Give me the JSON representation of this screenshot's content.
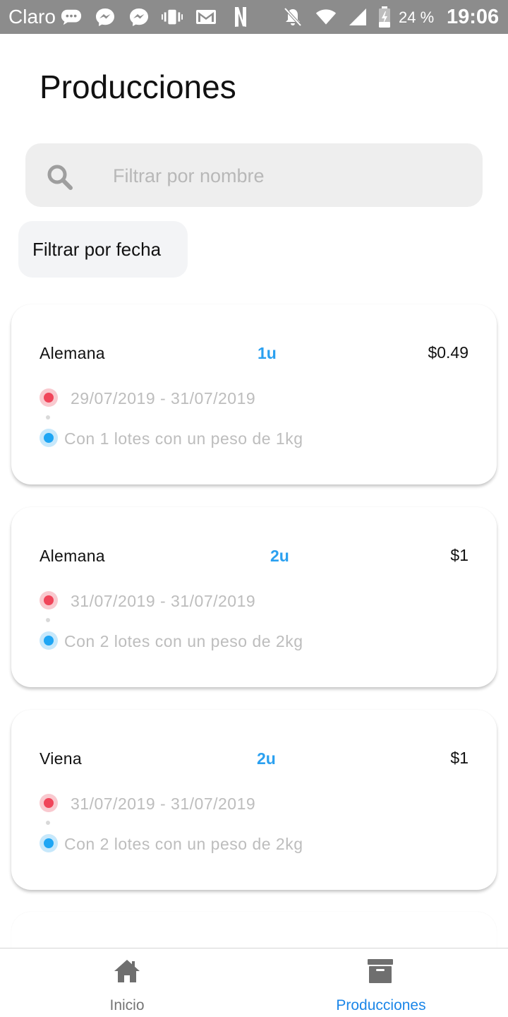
{
  "status_bar": {
    "carrier": "Claro",
    "battery": "24 %",
    "time": "19:06",
    "icons": [
      "chat-icon",
      "messenger-icon",
      "messenger-icon",
      "vibrate-icon",
      "gmail-icon",
      "netflix-icon",
      "bell-off-icon",
      "wifi-icon",
      "signal-icon",
      "battery-charging-icon"
    ]
  },
  "page": {
    "title": "Producciones"
  },
  "search": {
    "placeholder": "Filtrar por nombre",
    "value": ""
  },
  "date_filter": {
    "label": "Filtrar por fecha"
  },
  "productions": [
    {
      "name": "Alemana",
      "units": "1u",
      "price": "$0.49",
      "dates": "29/07/2019 - 31/07/2019",
      "lots": "Con 1 lotes con un peso de 1kg"
    },
    {
      "name": "Alemana",
      "units": "2u",
      "price": "$1",
      "dates": "31/07/2019 - 31/07/2019",
      "lots": "Con 2 lotes con un peso de 2kg"
    },
    {
      "name": "Viena",
      "units": "2u",
      "price": "$1",
      "dates": "31/07/2019 - 31/07/2019",
      "lots": "Con 2 lotes con un peso de 2kg"
    }
  ],
  "bottom_nav": {
    "items": [
      {
        "label": "Inicio",
        "icon": "home-icon",
        "active": false,
        "color": "#757575"
      },
      {
        "label": "Producciones",
        "icon": "archive-icon",
        "active": true,
        "color": "#1b86e8"
      }
    ]
  },
  "colors": {
    "accent": "#1b86e8",
    "units": "#2aa0f0",
    "date_dot": "#f0455a",
    "lots_dot": "#1fa6f4"
  }
}
